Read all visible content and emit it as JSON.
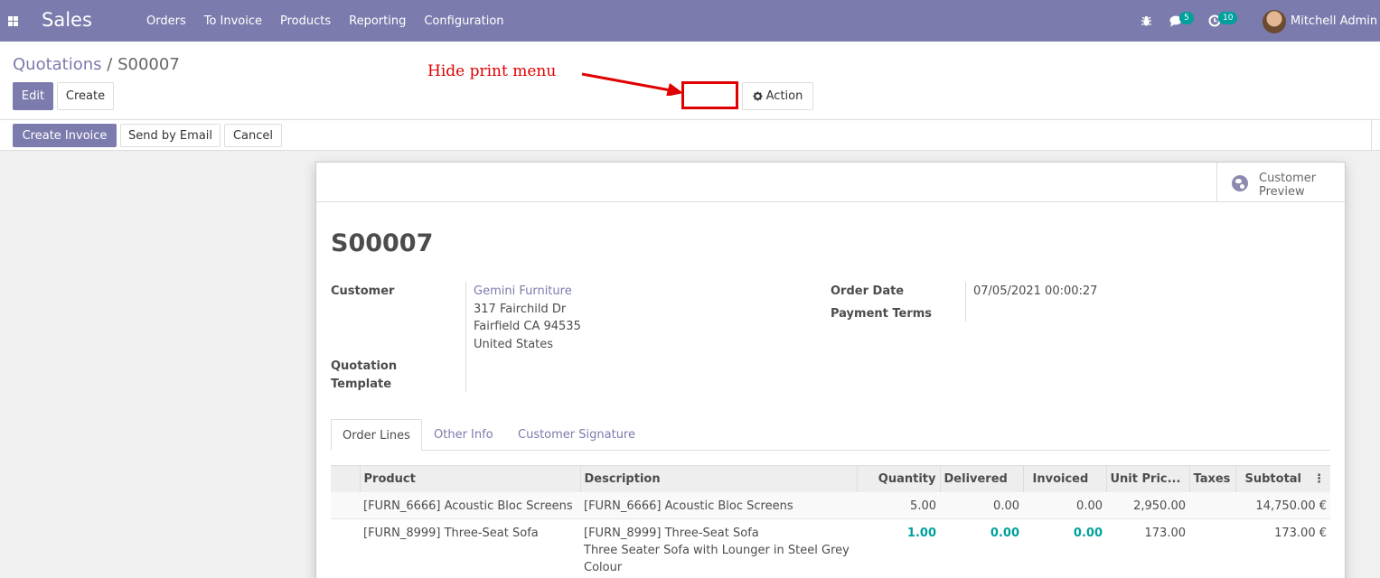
{
  "navbar": {
    "brand": "Sales",
    "menu": [
      "Orders",
      "To Invoice",
      "Products",
      "Reporting",
      "Configuration"
    ],
    "messages_count": "5",
    "activities_count": "10",
    "user_name": "Mitchell Admin"
  },
  "breadcrumb": {
    "parent": "Quotations",
    "separator": "/",
    "current": "S00007"
  },
  "control": {
    "edit_label": "Edit",
    "create_label": "Create",
    "action_label": "Action",
    "annotation": "Hide print menu"
  },
  "statusbar": {
    "create_invoice": "Create Invoice",
    "send_email": "Send by Email",
    "cancel": "Cancel"
  },
  "sheet": {
    "preview_label": "Customer Preview",
    "title": "S00007",
    "customer_label": "Customer",
    "customer_name": "Gemini Furniture",
    "address_line1": "317 Fairchild Dr",
    "address_line2": "Fairfield CA 94535",
    "address_line3": "United States",
    "quotation_template_label_1": "Quotation",
    "quotation_template_label_2": "Template",
    "order_date_label": "Order Date",
    "order_date_value": "07/05/2021 00:00:27",
    "payment_terms_label": "Payment Terms",
    "tabs": [
      "Order Lines",
      "Other Info",
      "Customer Signature"
    ],
    "columns": [
      "Product",
      "Description",
      "Quantity",
      "Delivered",
      "Invoiced",
      "Unit Pric...",
      "Taxes",
      "Subtotal"
    ],
    "rows": [
      {
        "product": "[FURN_6666] Acoustic Bloc Screens",
        "description": "[FURN_6666] Acoustic Bloc Screens",
        "description2": "",
        "quantity": "5.00",
        "delivered": "0.00",
        "invoiced": "0.00",
        "unit_price": "2,950.00",
        "taxes": "",
        "subtotal": "14,750.00 €"
      },
      {
        "product": "[FURN_8999] Three-Seat Sofa",
        "description": "[FURN_8999] Three-Seat Sofa",
        "description2": "Three Seater Sofa with Lounger in Steel Grey",
        "description3": "Colour",
        "quantity": "1.00",
        "delivered": "0.00",
        "invoiced": "0.00",
        "unit_price": "173.00",
        "taxes": "",
        "subtotal": "173.00 €"
      }
    ]
  },
  "colors": {
    "brand": "#7c7bad",
    "accent": "#00a09d",
    "annotation": "#e00000"
  },
  "icons": [
    "apps-icon",
    "bug-icon",
    "chat-icon",
    "clock-icon",
    "gear-icon",
    "globe-icon",
    "column-options-icon"
  ]
}
